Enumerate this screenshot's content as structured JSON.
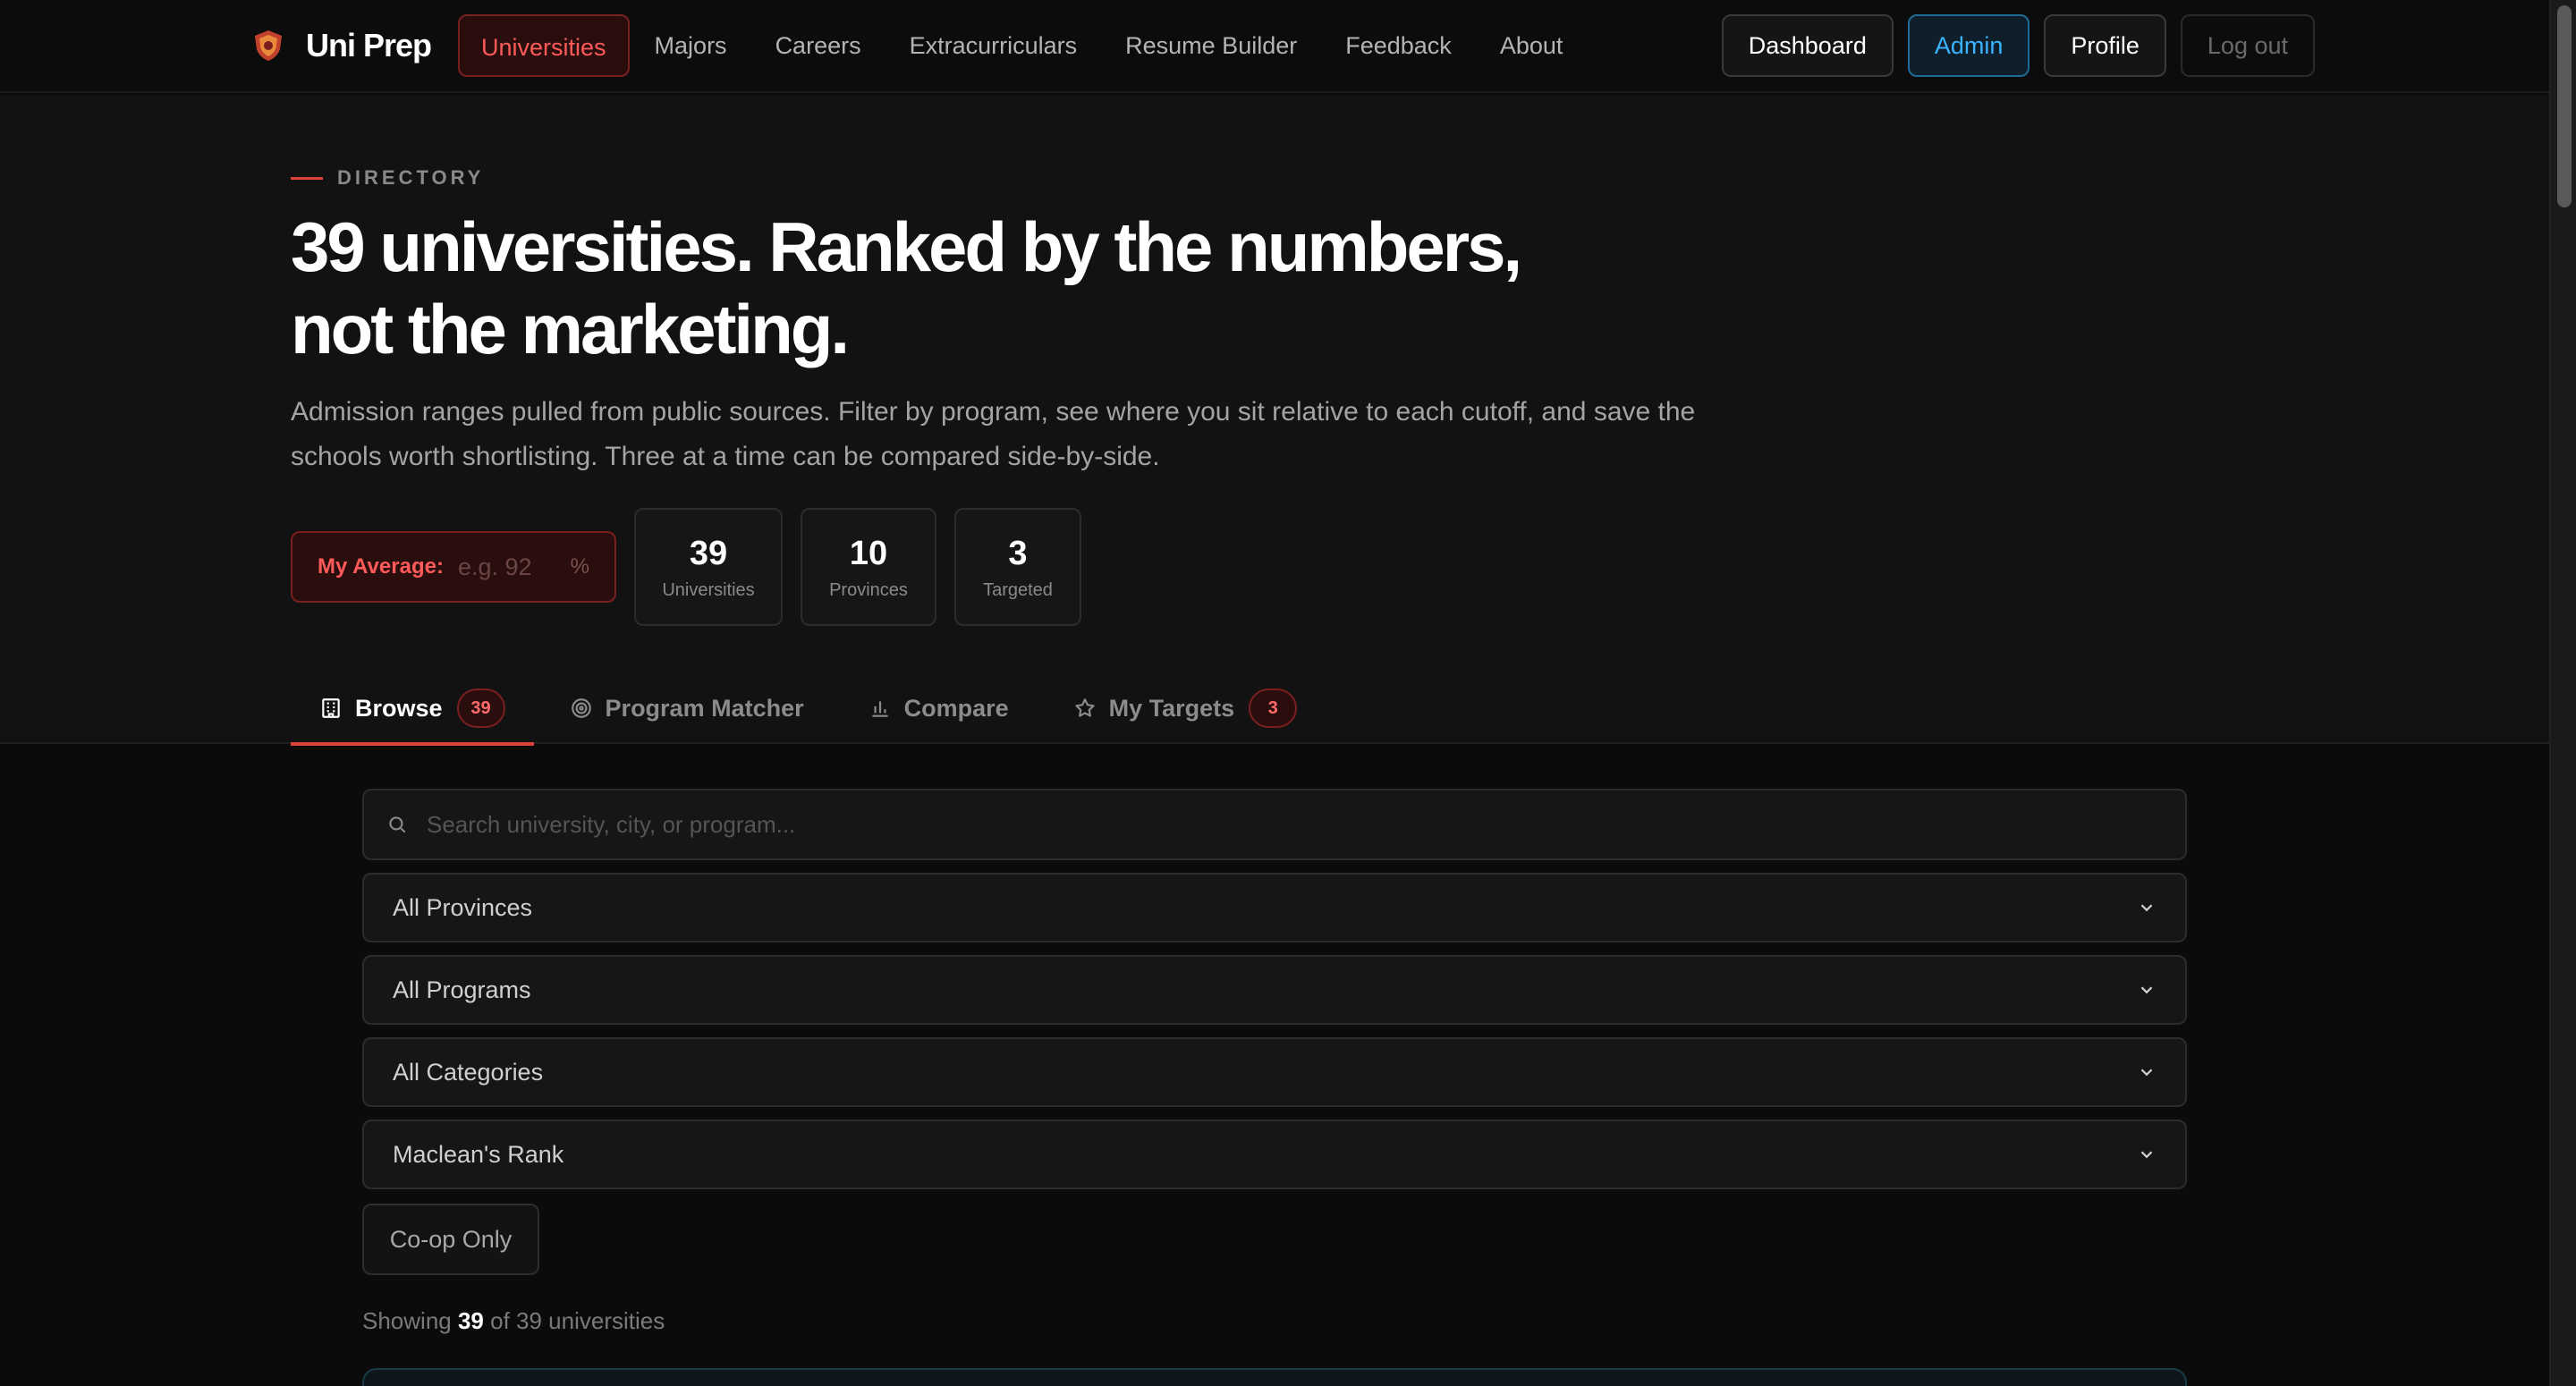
{
  "brand": {
    "name": "Uni Prep",
    "logo_icon": "crest-icon"
  },
  "nav": {
    "links": [
      "Universities",
      "Majors",
      "Careers",
      "Extracurriculars",
      "Resume Builder",
      "Feedback",
      "About"
    ],
    "active": "Universities",
    "buttons": {
      "dashboard": "Dashboard",
      "admin": "Admin",
      "profile": "Profile",
      "logout": "Log out"
    }
  },
  "hero": {
    "eyebrow": "DIRECTORY",
    "headline_line1": "39 universities. Ranked by the numbers,",
    "headline_line2": "not the marketing.",
    "subtext": "Admission ranges pulled from public sources. Filter by program, see where you sit relative to each cutoff, and save the schools worth shortlisting. Three at a time can be compared side-by-side.",
    "average": {
      "label": "My Average:",
      "placeholder": "e.g. 92",
      "unit": "%"
    },
    "stats": [
      {
        "value": "39",
        "label": "Universities"
      },
      {
        "value": "10",
        "label": "Provinces"
      },
      {
        "value": "3",
        "label": "Targeted"
      }
    ]
  },
  "tabs": [
    {
      "label": "Browse",
      "icon": "building-icon",
      "badge": "39",
      "active": true
    },
    {
      "label": "Program Matcher",
      "icon": "target-icon"
    },
    {
      "label": "Compare",
      "icon": "bar-chart-icon"
    },
    {
      "label": "My Targets",
      "icon": "star-icon",
      "badge": "3"
    }
  ],
  "filters": {
    "search_placeholder": "Search university, city, or program...",
    "province": "All Provinces",
    "program": "All Programs",
    "category": "All Categories",
    "sort": "Maclean's Rank",
    "coop": "Co-op Only"
  },
  "results": {
    "prefix": "Showing",
    "count": "39",
    "suffix": "of 39 universities"
  },
  "colors": {
    "accent": "#e0413b",
    "admin": "#3bb4ff",
    "background": "#0b0b0b"
  }
}
